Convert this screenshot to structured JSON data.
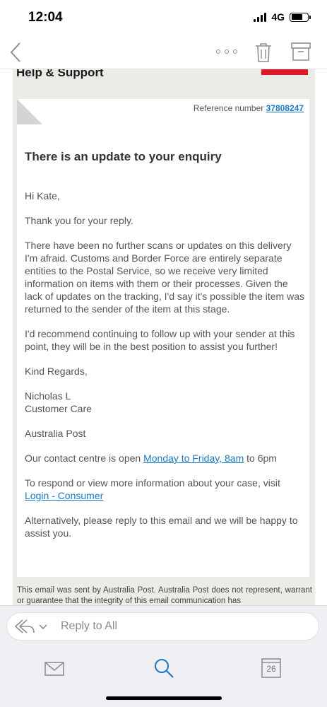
{
  "status": {
    "time": "12:04",
    "network": "4G"
  },
  "toolbar": {
    "icons": [
      "back-icon",
      "more-icon",
      "trash-icon",
      "archive-icon"
    ]
  },
  "email": {
    "heading": "Help & Support",
    "reference_label": "Reference number",
    "reference_number": "37808247",
    "title": "There is an update to your enquiry",
    "greeting": "Hi Kate,",
    "para1": "Thank you for your reply.",
    "para2": "There have been no further scans or updates on this delivery I'm afraid. Customs and Border Force are entirely separate entities to the Postal Service, so we receive very limited information on items with them or their processes. Given the lack of updates on the tracking, I'd say it's possible the item was returned to the sender of the item at this stage.",
    "para3": "I'd recommend continuing to follow up with your sender at this point, they will be in the best position to assist you further!",
    "closing": "Kind Regards,",
    "signature_name": "Nicholas L",
    "signature_role": "Customer Care",
    "company": "Australia Post",
    "contact_prefix": "Our contact centre is open ",
    "contact_link": "Monday to Friday, 8am",
    "contact_suffix": " to 6pm",
    "respond_text": "To respond or view more information about your case, visit ",
    "login_link": "Login - Consumer",
    "alt_text": "Alternatively, please reply to this email and we will be happy to assist you.",
    "footer_note": "This email was sent by Australia Post. Australia Post does not represent, warrant or guarantee that the integrity of this email communication has"
  },
  "reply": {
    "placeholder": "Reply to All"
  },
  "nav": {
    "calendar_day": "26"
  },
  "colors": {
    "link": "#1d79c2",
    "brand_red": "#dc1928",
    "frame_bg": "#ecebe8"
  }
}
